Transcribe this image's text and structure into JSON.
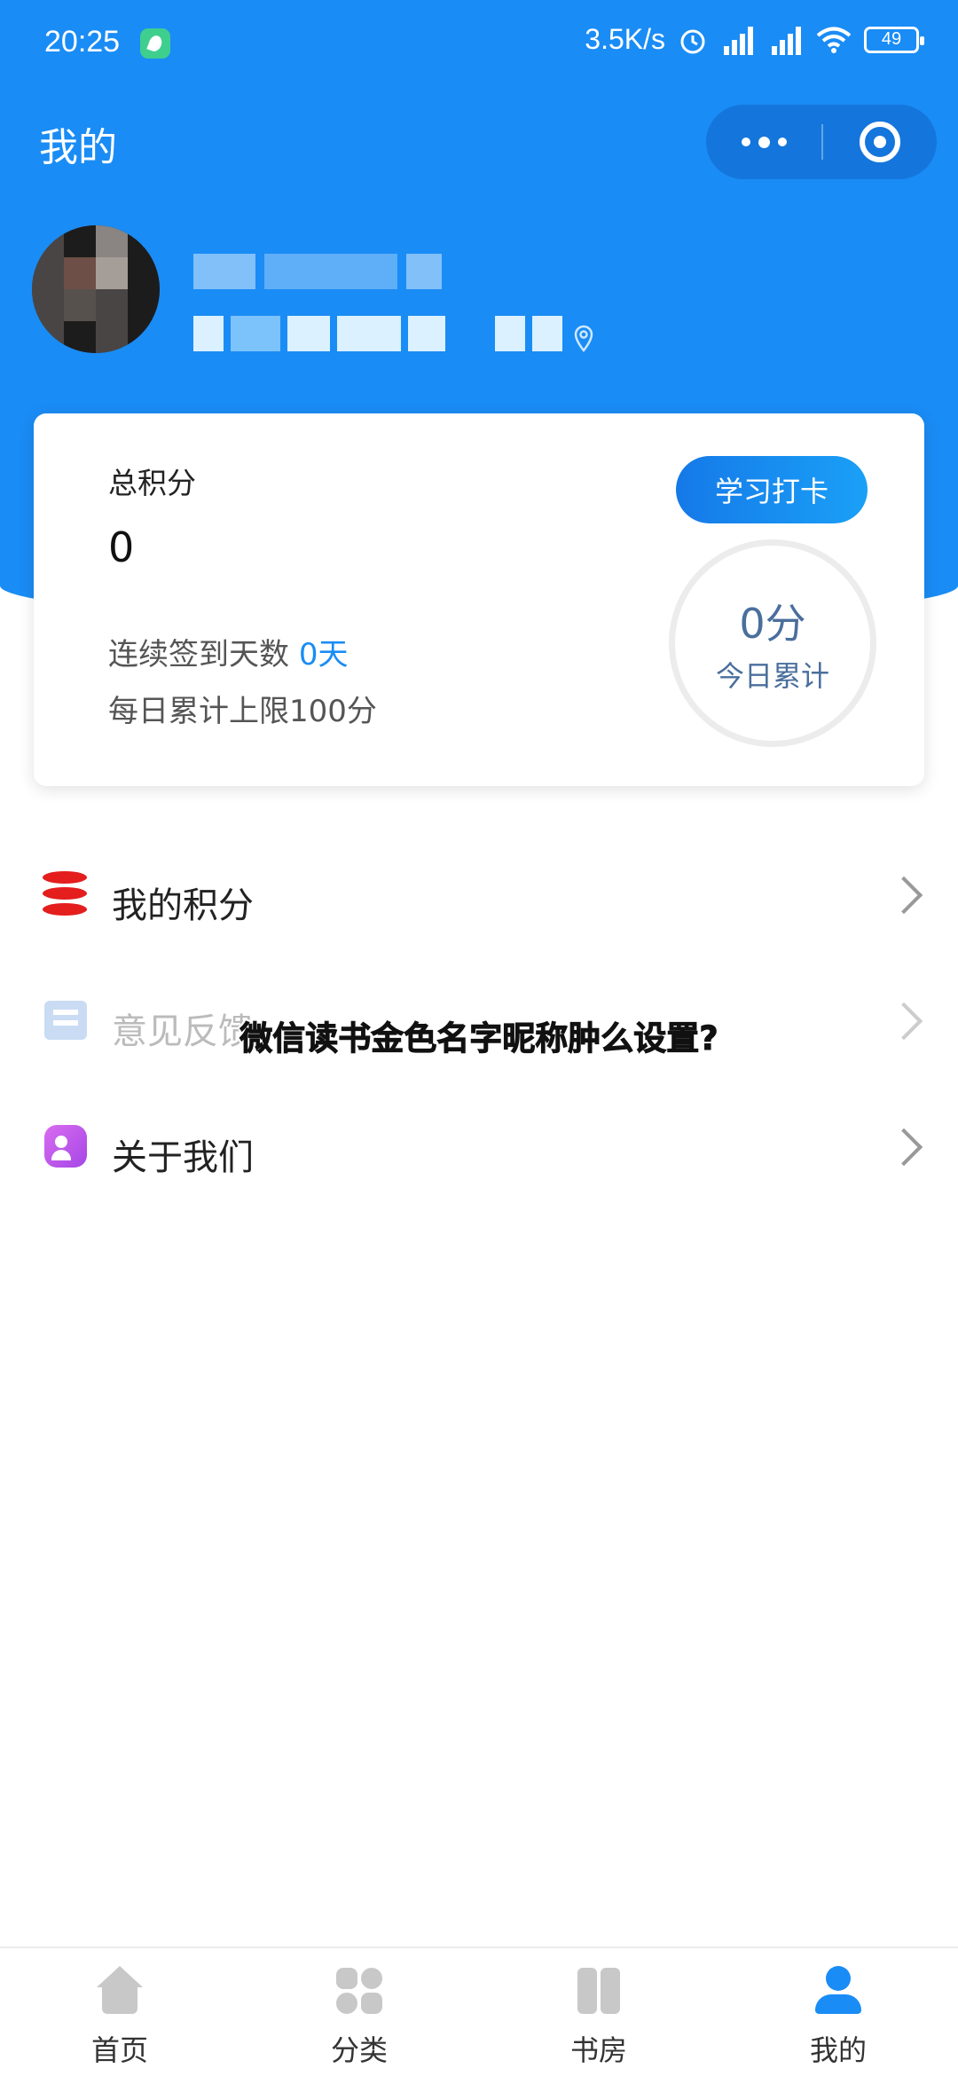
{
  "status_bar": {
    "time": "20:25",
    "network_speed": "3.5K/s",
    "battery": "49"
  },
  "header": {
    "title": "我的"
  },
  "points_card": {
    "total_label": "总积分",
    "total_value": "0",
    "streak_prefix": "连续签到天数 ",
    "streak_value": "0天",
    "daily_limit": "每日累计上限100分",
    "checkin_button": "学习打卡",
    "today_value": "0分",
    "today_label": "今日累计"
  },
  "menu": {
    "items": [
      {
        "label": "我的积分",
        "icon": "coins-stack-icon"
      },
      {
        "label": "意见反馈",
        "icon": "feedback-icon"
      },
      {
        "label": "关于我们",
        "icon": "about-us-icon"
      }
    ]
  },
  "overlay": {
    "caption": "微信读书金色名字昵称肿么设置?"
  },
  "bottom_nav": {
    "items": [
      {
        "label": "首页",
        "icon": "home-icon"
      },
      {
        "label": "分类",
        "icon": "category-icon"
      },
      {
        "label": "书房",
        "icon": "bookshelf-icon"
      },
      {
        "label": "我的",
        "icon": "profile-icon"
      }
    ],
    "active": "我的"
  },
  "colors": {
    "primary": "#1a8cf5",
    "points_icon": "#e41d1d",
    "about_icon": "#b855ea"
  }
}
